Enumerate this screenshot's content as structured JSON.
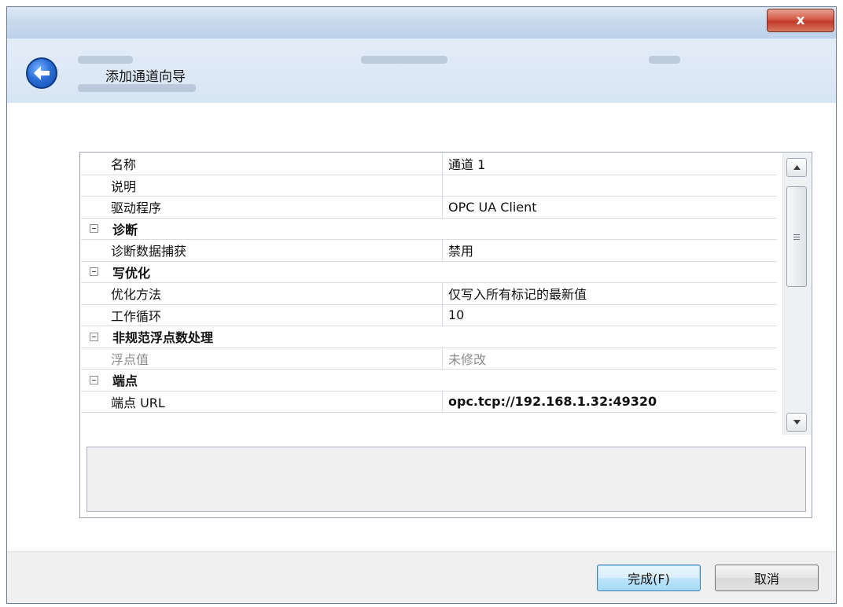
{
  "window": {
    "close_label": "x",
    "wizard_title": "添加通道向导"
  },
  "properties": [
    {
      "type": "prop",
      "name": "名称",
      "value": "通道 1"
    },
    {
      "type": "prop",
      "name": "说明",
      "value": ""
    },
    {
      "type": "prop",
      "name": "驱动程序",
      "value": "OPC UA Client"
    },
    {
      "type": "category",
      "name": "诊断"
    },
    {
      "type": "prop",
      "name": "诊断数据捕获",
      "value": "禁用"
    },
    {
      "type": "category",
      "name": "写优化"
    },
    {
      "type": "prop",
      "name": "优化方法",
      "value": "仅写入所有标记的最新值"
    },
    {
      "type": "prop",
      "name": "工作循环",
      "value": "10"
    },
    {
      "type": "category",
      "name": "非规范浮点数处理"
    },
    {
      "type": "prop",
      "name": "浮点值",
      "value": "未修改",
      "disabled": true
    },
    {
      "type": "category",
      "name": "端点"
    },
    {
      "type": "prop",
      "name": "端点 URL",
      "value": "opc.tcp://192.168.1.32:49320",
      "bold": true
    }
  ],
  "footer": {
    "finish_label": "完成(F)",
    "cancel_label": "取消"
  },
  "icons": {
    "back": "back-arrow-icon",
    "collapse": "collapse-minus-icon",
    "scroll_up": "scroll-up-arrow-icon",
    "scroll_down": "scroll-down-arrow-icon"
  }
}
